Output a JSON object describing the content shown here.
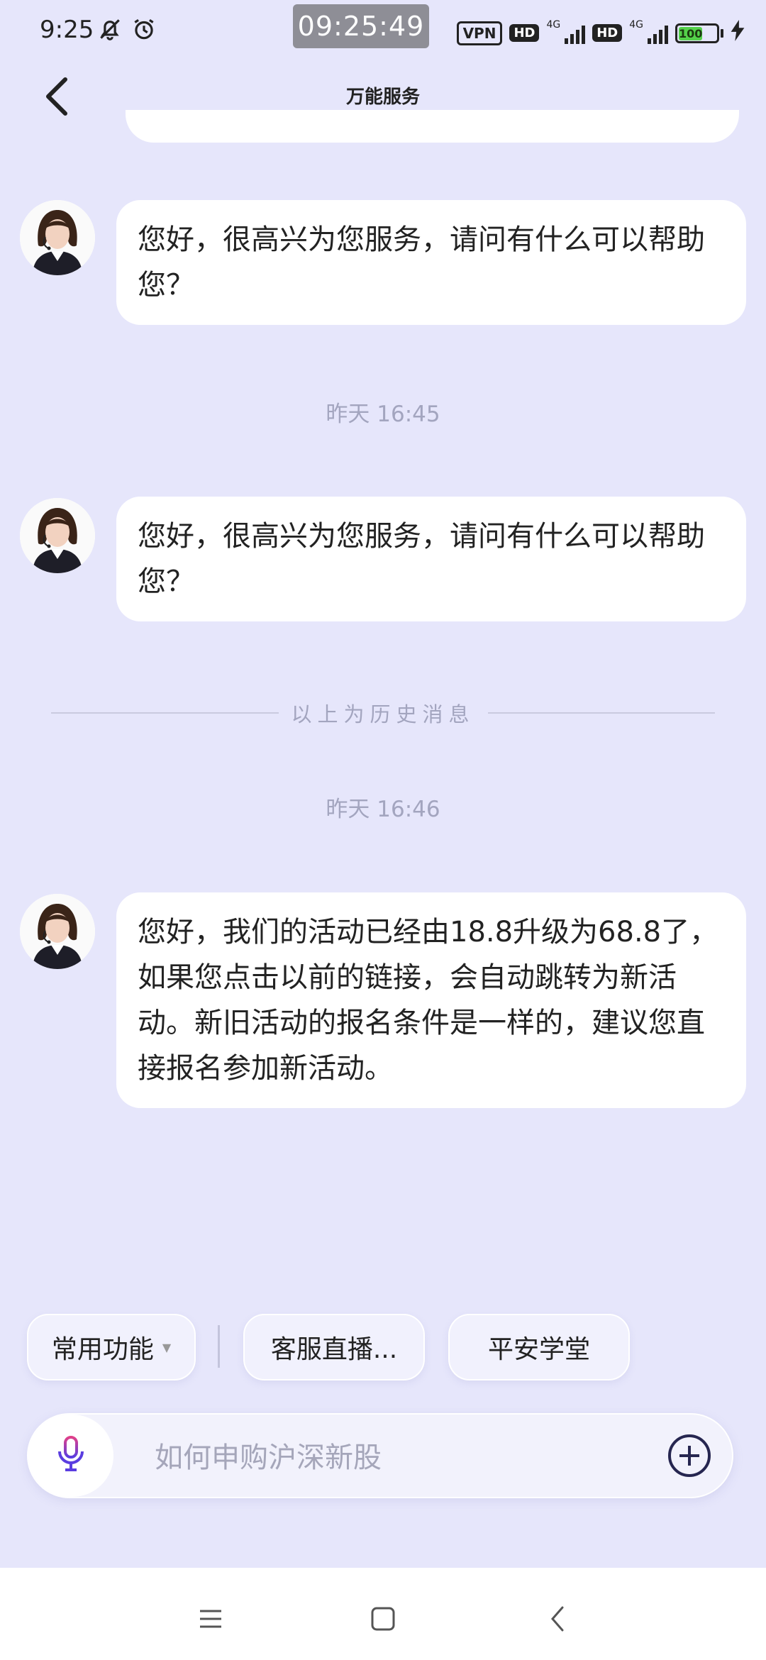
{
  "status_bar": {
    "time": "9:25",
    "clock_overlay": "09:25:49",
    "vpn": "VPN",
    "hd1": "HD",
    "hd2": "HD",
    "net1": "4G",
    "net2": "4G",
    "battery": "100"
  },
  "header": {
    "title": "万能服务"
  },
  "messages": [
    {
      "text": "您好，很高兴为您服务，请问有什么可以帮助您？"
    },
    {
      "text": "您好，很高兴为您服务，请问有什么可以帮助您？"
    },
    {
      "text": "您好，我们的活动已经由18.8升级为68.8了，如果您点击以前的链接，会自动跳转为新活动。新旧活动的报名条件是一样的，建议您直接报名参加新活动。"
    }
  ],
  "timestamps": [
    "昨天 16:45",
    "昨天 16:46"
  ],
  "history_divider": "以上为历史消息",
  "quick_actions": {
    "common": "常用功能",
    "live": "客服直播...",
    "academy": "平安学堂"
  },
  "input": {
    "placeholder": "如何申购沪深新股"
  },
  "colors": {
    "background": "#e6e6fb",
    "bubble": "#ffffff",
    "accent": "#6a3fd9",
    "battery": "#54d14a"
  },
  "icons": [
    "bell-off-icon",
    "alarm-icon",
    "back-arrow-icon",
    "microphone-icon",
    "plus-circle-icon",
    "menu-icon",
    "home-square-icon",
    "nav-back-icon"
  ]
}
